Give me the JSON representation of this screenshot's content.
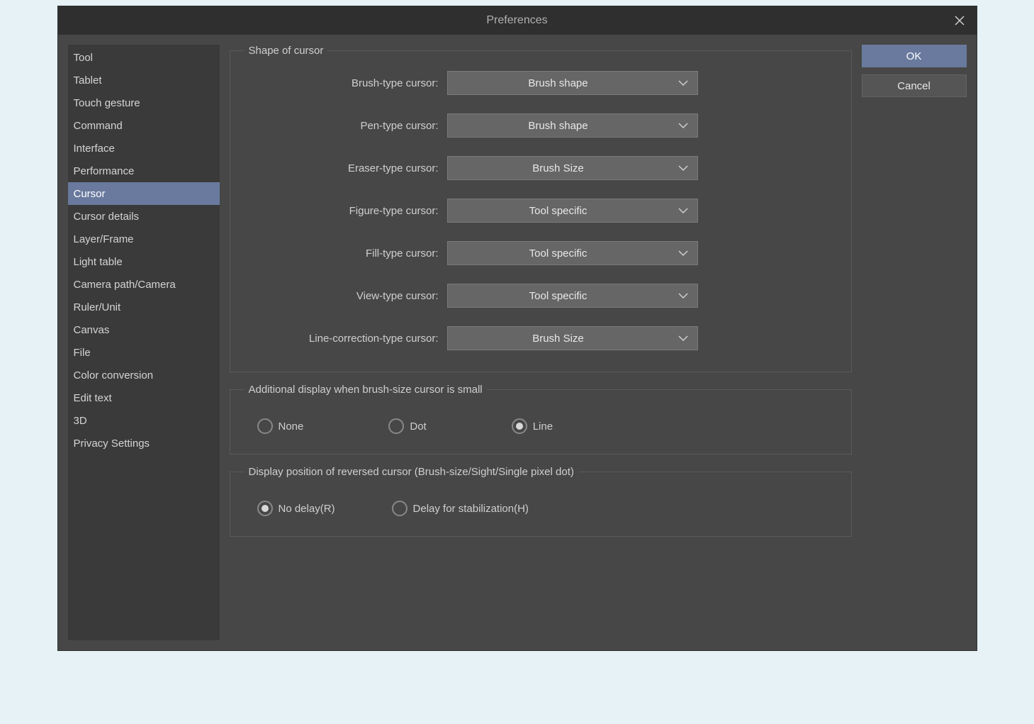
{
  "window": {
    "title": "Preferences"
  },
  "sidebar": {
    "items": [
      {
        "label": "Tool",
        "selected": false
      },
      {
        "label": "Tablet",
        "selected": false
      },
      {
        "label": "Touch gesture",
        "selected": false
      },
      {
        "label": "Command",
        "selected": false
      },
      {
        "label": "Interface",
        "selected": false
      },
      {
        "label": "Performance",
        "selected": false
      },
      {
        "label": "Cursor",
        "selected": true
      },
      {
        "label": "Cursor details",
        "selected": false
      },
      {
        "label": "Layer/Frame",
        "selected": false
      },
      {
        "label": "Light table",
        "selected": false
      },
      {
        "label": "Camera path/Camera",
        "selected": false
      },
      {
        "label": "Ruler/Unit",
        "selected": false
      },
      {
        "label": "Canvas",
        "selected": false
      },
      {
        "label": "File",
        "selected": false
      },
      {
        "label": "Color conversion",
        "selected": false
      },
      {
        "label": "Edit text",
        "selected": false
      },
      {
        "label": "3D",
        "selected": false
      },
      {
        "label": "Privacy Settings",
        "selected": false
      }
    ]
  },
  "buttons": {
    "ok": "OK",
    "cancel": "Cancel"
  },
  "groups": {
    "shape": {
      "legend": "Shape of cursor",
      "rows": [
        {
          "label": "Brush-type cursor:",
          "value": "Brush shape"
        },
        {
          "label": "Pen-type cursor:",
          "value": "Brush shape"
        },
        {
          "label": "Eraser-type cursor:",
          "value": "Brush Size"
        },
        {
          "label": "Figure-type cursor:",
          "value": "Tool specific"
        },
        {
          "label": "Fill-type cursor:",
          "value": "Tool specific"
        },
        {
          "label": "View-type cursor:",
          "value": "Tool specific"
        },
        {
          "label": "Line-correction-type cursor:",
          "value": "Brush Size"
        }
      ]
    },
    "additional": {
      "legend": "Additional display when brush-size cursor is small",
      "options": [
        {
          "label": "None",
          "checked": false
        },
        {
          "label": "Dot",
          "checked": false
        },
        {
          "label": "Line",
          "checked": true
        }
      ]
    },
    "reversed": {
      "legend": "Display position of reversed cursor (Brush-size/Sight/Single pixel dot)",
      "options": [
        {
          "label": "No delay(R)",
          "checked": true
        },
        {
          "label": "Delay for stabilization(H)",
          "checked": false
        }
      ]
    }
  }
}
